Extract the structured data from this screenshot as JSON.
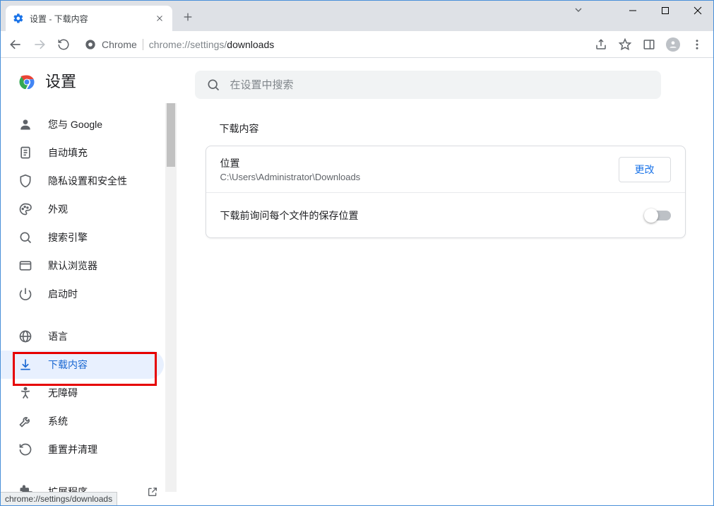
{
  "window": {
    "tab_title": "设置 - 下载内容",
    "statusbar": "chrome://settings/downloads"
  },
  "addressbar": {
    "origin_label": "Chrome",
    "url_prefix": "chrome://settings/",
    "url_path": "downloads"
  },
  "brand": {
    "title": "设置"
  },
  "search": {
    "placeholder": "在设置中搜索"
  },
  "sidebar": {
    "items": [
      {
        "icon": "person-icon",
        "label": "您与 Google"
      },
      {
        "icon": "autofill-icon",
        "label": "自动填充"
      },
      {
        "icon": "shield-icon",
        "label": "隐私设置和安全性"
      },
      {
        "icon": "palette-icon",
        "label": "外观"
      },
      {
        "icon": "search-icon",
        "label": "搜索引擎"
      },
      {
        "icon": "browser-icon",
        "label": "默认浏览器"
      },
      {
        "icon": "power-icon",
        "label": "启动时"
      },
      {
        "icon": "globe-icon",
        "label": "语言"
      },
      {
        "icon": "download-icon",
        "label": "下载内容",
        "active": true
      },
      {
        "icon": "accessibility-icon",
        "label": "无障碍"
      },
      {
        "icon": "wrench-icon",
        "label": "系统"
      },
      {
        "icon": "restore-icon",
        "label": "重置并清理"
      },
      {
        "icon": "extension-icon",
        "label": "扩展程序",
        "external": true
      }
    ]
  },
  "content": {
    "section_title": "下载内容",
    "location": {
      "label": "位置",
      "path": "C:\\Users\\Administrator\\Downloads",
      "change_button": "更改"
    },
    "ask_row": {
      "label": "下载前询问每个文件的保存位置",
      "enabled": false
    }
  }
}
